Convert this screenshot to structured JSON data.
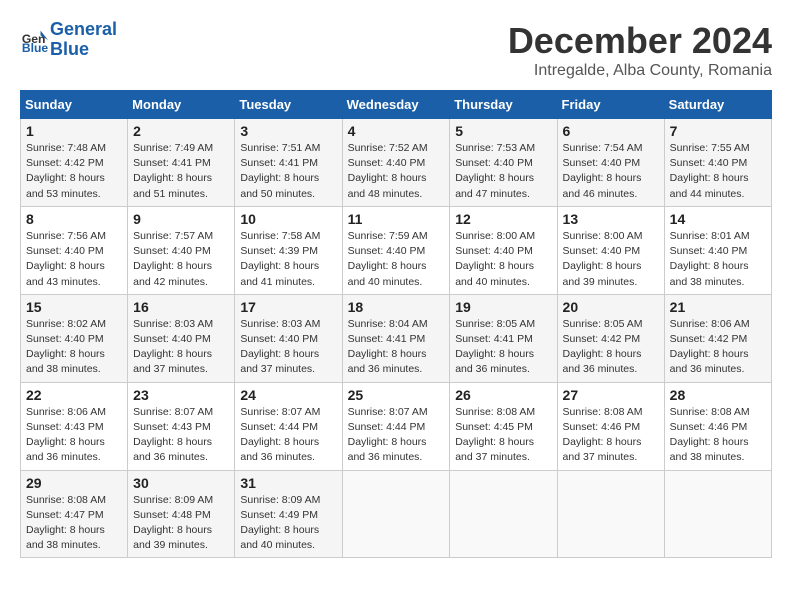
{
  "header": {
    "logo_line1": "General",
    "logo_line2": "Blue",
    "month_title": "December 2024",
    "subtitle": "Intregalde, Alba County, Romania"
  },
  "days_of_week": [
    "Sunday",
    "Monday",
    "Tuesday",
    "Wednesday",
    "Thursday",
    "Friday",
    "Saturday"
  ],
  "weeks": [
    [
      {
        "day": "1",
        "sunrise": "Sunrise: 7:48 AM",
        "sunset": "Sunset: 4:42 PM",
        "daylight": "Daylight: 8 hours and 53 minutes."
      },
      {
        "day": "2",
        "sunrise": "Sunrise: 7:49 AM",
        "sunset": "Sunset: 4:41 PM",
        "daylight": "Daylight: 8 hours and 51 minutes."
      },
      {
        "day": "3",
        "sunrise": "Sunrise: 7:51 AM",
        "sunset": "Sunset: 4:41 PM",
        "daylight": "Daylight: 8 hours and 50 minutes."
      },
      {
        "day": "4",
        "sunrise": "Sunrise: 7:52 AM",
        "sunset": "Sunset: 4:40 PM",
        "daylight": "Daylight: 8 hours and 48 minutes."
      },
      {
        "day": "5",
        "sunrise": "Sunrise: 7:53 AM",
        "sunset": "Sunset: 4:40 PM",
        "daylight": "Daylight: 8 hours and 47 minutes."
      },
      {
        "day": "6",
        "sunrise": "Sunrise: 7:54 AM",
        "sunset": "Sunset: 4:40 PM",
        "daylight": "Daylight: 8 hours and 46 minutes."
      },
      {
        "day": "7",
        "sunrise": "Sunrise: 7:55 AM",
        "sunset": "Sunset: 4:40 PM",
        "daylight": "Daylight: 8 hours and 44 minutes."
      }
    ],
    [
      {
        "day": "8",
        "sunrise": "Sunrise: 7:56 AM",
        "sunset": "Sunset: 4:40 PM",
        "daylight": "Daylight: 8 hours and 43 minutes."
      },
      {
        "day": "9",
        "sunrise": "Sunrise: 7:57 AM",
        "sunset": "Sunset: 4:40 PM",
        "daylight": "Daylight: 8 hours and 42 minutes."
      },
      {
        "day": "10",
        "sunrise": "Sunrise: 7:58 AM",
        "sunset": "Sunset: 4:39 PM",
        "daylight": "Daylight: 8 hours and 41 minutes."
      },
      {
        "day": "11",
        "sunrise": "Sunrise: 7:59 AM",
        "sunset": "Sunset: 4:40 PM",
        "daylight": "Daylight: 8 hours and 40 minutes."
      },
      {
        "day": "12",
        "sunrise": "Sunrise: 8:00 AM",
        "sunset": "Sunset: 4:40 PM",
        "daylight": "Daylight: 8 hours and 40 minutes."
      },
      {
        "day": "13",
        "sunrise": "Sunrise: 8:00 AM",
        "sunset": "Sunset: 4:40 PM",
        "daylight": "Daylight: 8 hours and 39 minutes."
      },
      {
        "day": "14",
        "sunrise": "Sunrise: 8:01 AM",
        "sunset": "Sunset: 4:40 PM",
        "daylight": "Daylight: 8 hours and 38 minutes."
      }
    ],
    [
      {
        "day": "15",
        "sunrise": "Sunrise: 8:02 AM",
        "sunset": "Sunset: 4:40 PM",
        "daylight": "Daylight: 8 hours and 38 minutes."
      },
      {
        "day": "16",
        "sunrise": "Sunrise: 8:03 AM",
        "sunset": "Sunset: 4:40 PM",
        "daylight": "Daylight: 8 hours and 37 minutes."
      },
      {
        "day": "17",
        "sunrise": "Sunrise: 8:03 AM",
        "sunset": "Sunset: 4:40 PM",
        "daylight": "Daylight: 8 hours and 37 minutes."
      },
      {
        "day": "18",
        "sunrise": "Sunrise: 8:04 AM",
        "sunset": "Sunset: 4:41 PM",
        "daylight": "Daylight: 8 hours and 36 minutes."
      },
      {
        "day": "19",
        "sunrise": "Sunrise: 8:05 AM",
        "sunset": "Sunset: 4:41 PM",
        "daylight": "Daylight: 8 hours and 36 minutes."
      },
      {
        "day": "20",
        "sunrise": "Sunrise: 8:05 AM",
        "sunset": "Sunset: 4:42 PM",
        "daylight": "Daylight: 8 hours and 36 minutes."
      },
      {
        "day": "21",
        "sunrise": "Sunrise: 8:06 AM",
        "sunset": "Sunset: 4:42 PM",
        "daylight": "Daylight: 8 hours and 36 minutes."
      }
    ],
    [
      {
        "day": "22",
        "sunrise": "Sunrise: 8:06 AM",
        "sunset": "Sunset: 4:43 PM",
        "daylight": "Daylight: 8 hours and 36 minutes."
      },
      {
        "day": "23",
        "sunrise": "Sunrise: 8:07 AM",
        "sunset": "Sunset: 4:43 PM",
        "daylight": "Daylight: 8 hours and 36 minutes."
      },
      {
        "day": "24",
        "sunrise": "Sunrise: 8:07 AM",
        "sunset": "Sunset: 4:44 PM",
        "daylight": "Daylight: 8 hours and 36 minutes."
      },
      {
        "day": "25",
        "sunrise": "Sunrise: 8:07 AM",
        "sunset": "Sunset: 4:44 PM",
        "daylight": "Daylight: 8 hours and 36 minutes."
      },
      {
        "day": "26",
        "sunrise": "Sunrise: 8:08 AM",
        "sunset": "Sunset: 4:45 PM",
        "daylight": "Daylight: 8 hours and 37 minutes."
      },
      {
        "day": "27",
        "sunrise": "Sunrise: 8:08 AM",
        "sunset": "Sunset: 4:46 PM",
        "daylight": "Daylight: 8 hours and 37 minutes."
      },
      {
        "day": "28",
        "sunrise": "Sunrise: 8:08 AM",
        "sunset": "Sunset: 4:46 PM",
        "daylight": "Daylight: 8 hours and 38 minutes."
      }
    ],
    [
      {
        "day": "29",
        "sunrise": "Sunrise: 8:08 AM",
        "sunset": "Sunset: 4:47 PM",
        "daylight": "Daylight: 8 hours and 38 minutes."
      },
      {
        "day": "30",
        "sunrise": "Sunrise: 8:09 AM",
        "sunset": "Sunset: 4:48 PM",
        "daylight": "Daylight: 8 hours and 39 minutes."
      },
      {
        "day": "31",
        "sunrise": "Sunrise: 8:09 AM",
        "sunset": "Sunset: 4:49 PM",
        "daylight": "Daylight: 8 hours and 40 minutes."
      },
      null,
      null,
      null,
      null
    ]
  ]
}
